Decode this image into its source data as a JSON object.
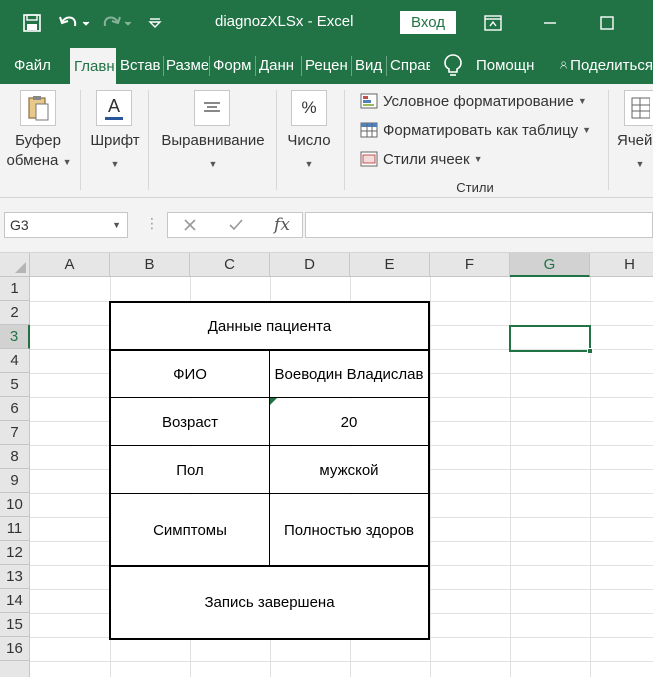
{
  "app": {
    "title": "diagnozXLSx  -  Excel",
    "login_label": "Вход",
    "colors": {
      "accent": "#217346",
      "ribbon_bg": "#f3f3f3"
    }
  },
  "tabs": [
    {
      "label": "Файл",
      "active": false
    },
    {
      "label": "Главн",
      "active": true
    },
    {
      "label": "Встав",
      "active": false
    },
    {
      "label": "Разме",
      "active": false
    },
    {
      "label": "Форм",
      "active": false
    },
    {
      "label": "Данн",
      "active": false
    },
    {
      "label": "Рецен",
      "active": false
    },
    {
      "label": "Вид",
      "active": false
    },
    {
      "label": "Справ",
      "active": false
    },
    {
      "label": "Помощн",
      "active": false
    },
    {
      "label": "Поделиться",
      "active": false
    }
  ],
  "ribbon": {
    "clipboard_line1": "Буфер",
    "clipboard_line2": "обмена",
    "font_label": "Шрифт",
    "align_label": "Выравнивание",
    "number_label": "Число",
    "cond_format": "Условное форматирование",
    "format_table": "Форматировать как таблицу",
    "cell_styles": "Стили ячеек",
    "styles_group": "Стили",
    "cells_label": "Ячей",
    "number_icon_text": "%",
    "font_icon_text": "A"
  },
  "formula_bar": {
    "name_box": "G3",
    "fx": "fx",
    "value": ""
  },
  "sheet": {
    "columns": [
      "A",
      "B",
      "C",
      "D",
      "E",
      "F",
      "G",
      "H"
    ],
    "rows": [
      "1",
      "2",
      "3",
      "4",
      "5",
      "6",
      "7",
      "8",
      "9",
      "10",
      "11",
      "12",
      "13",
      "14",
      "15",
      "16"
    ],
    "selected_column": "G",
    "selected_row": "3"
  },
  "patient_table": {
    "header": "Данные пациента",
    "fio_label": "ФИО",
    "fio_value": "Воеводин Владислав",
    "age_label": "Возраст",
    "age_value": "20",
    "sex_label": "Пол",
    "sex_value": "мужской",
    "symptoms_label": "Симптомы",
    "symptoms_value": "Полностью здоров",
    "footer": "Запись завершена"
  }
}
